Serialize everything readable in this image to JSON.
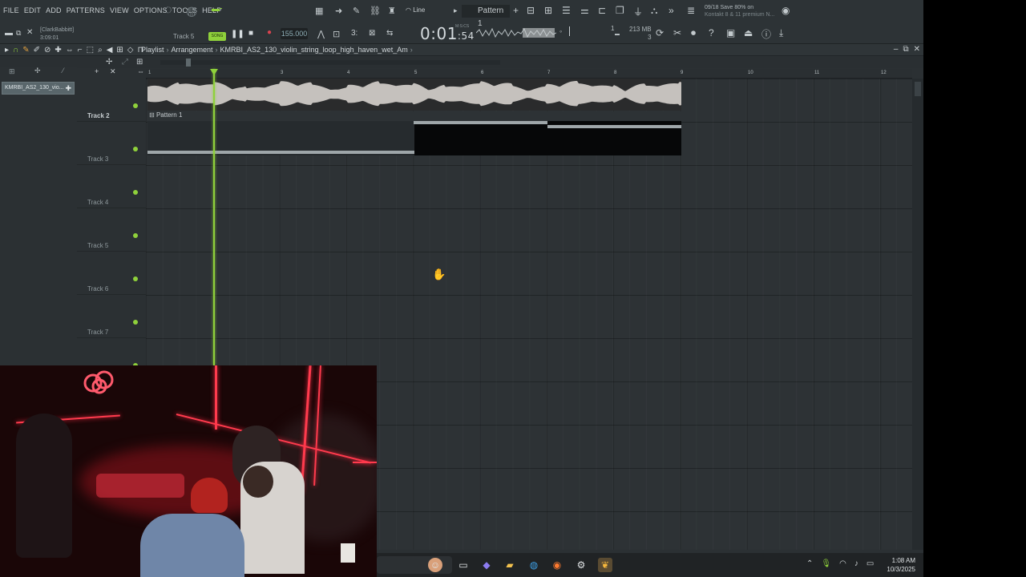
{
  "menu": [
    "FILE",
    "EDIT",
    "ADD",
    "PATTERNS",
    "VIEW",
    "OPTIONS",
    "TOOLS",
    "HELP"
  ],
  "user": {
    "name": "[ClarkBabbitt]",
    "elapsed": "3:09:01"
  },
  "transport": {
    "track_hint": "Track 5",
    "song_mode": "SONG",
    "tempo": "155.000",
    "time_main": "0:01",
    "time_sub": "54",
    "time_unit": "M:S:CS"
  },
  "snap": {
    "label": "Line"
  },
  "pattern_selector": {
    "label": "Pattern 1"
  },
  "cpu": {
    "memory": "213 MB",
    "polyphony": "3",
    "value": "1"
  },
  "news": {
    "line1": "09/18  Save 80% on",
    "line2": "Kontakt 8 & 11 premium N..."
  },
  "playlist": {
    "title": "Playlist",
    "section": "Arrangement",
    "clip_name": "KMRBI_AS2_130_violin_string_loop_high_haven_wet_Am"
  },
  "picker": {
    "selected": "KMRBI_AS2_130_vio..."
  },
  "ruler": {
    "bars": [
      "1",
      "3",
      "4",
      "5",
      "6",
      "7",
      "8",
      "9",
      "10",
      "11",
      "12"
    ]
  },
  "tracks": [
    {
      "name": "Track 2",
      "active": true
    },
    {
      "name": "Track 3",
      "active": false
    },
    {
      "name": "Track 4",
      "active": false
    },
    {
      "name": "Track 5",
      "active": false
    },
    {
      "name": "Track 6",
      "active": false
    },
    {
      "name": "Track 7",
      "active": false
    }
  ],
  "clips": {
    "pattern_label": "Pattern 1"
  },
  "taskbar": {
    "time": "1:08 AM",
    "date": "10/3/2025"
  },
  "colors": {
    "accent": "#8fd13b",
    "panel": "#2b3033",
    "neon": "#ff3b4d"
  }
}
